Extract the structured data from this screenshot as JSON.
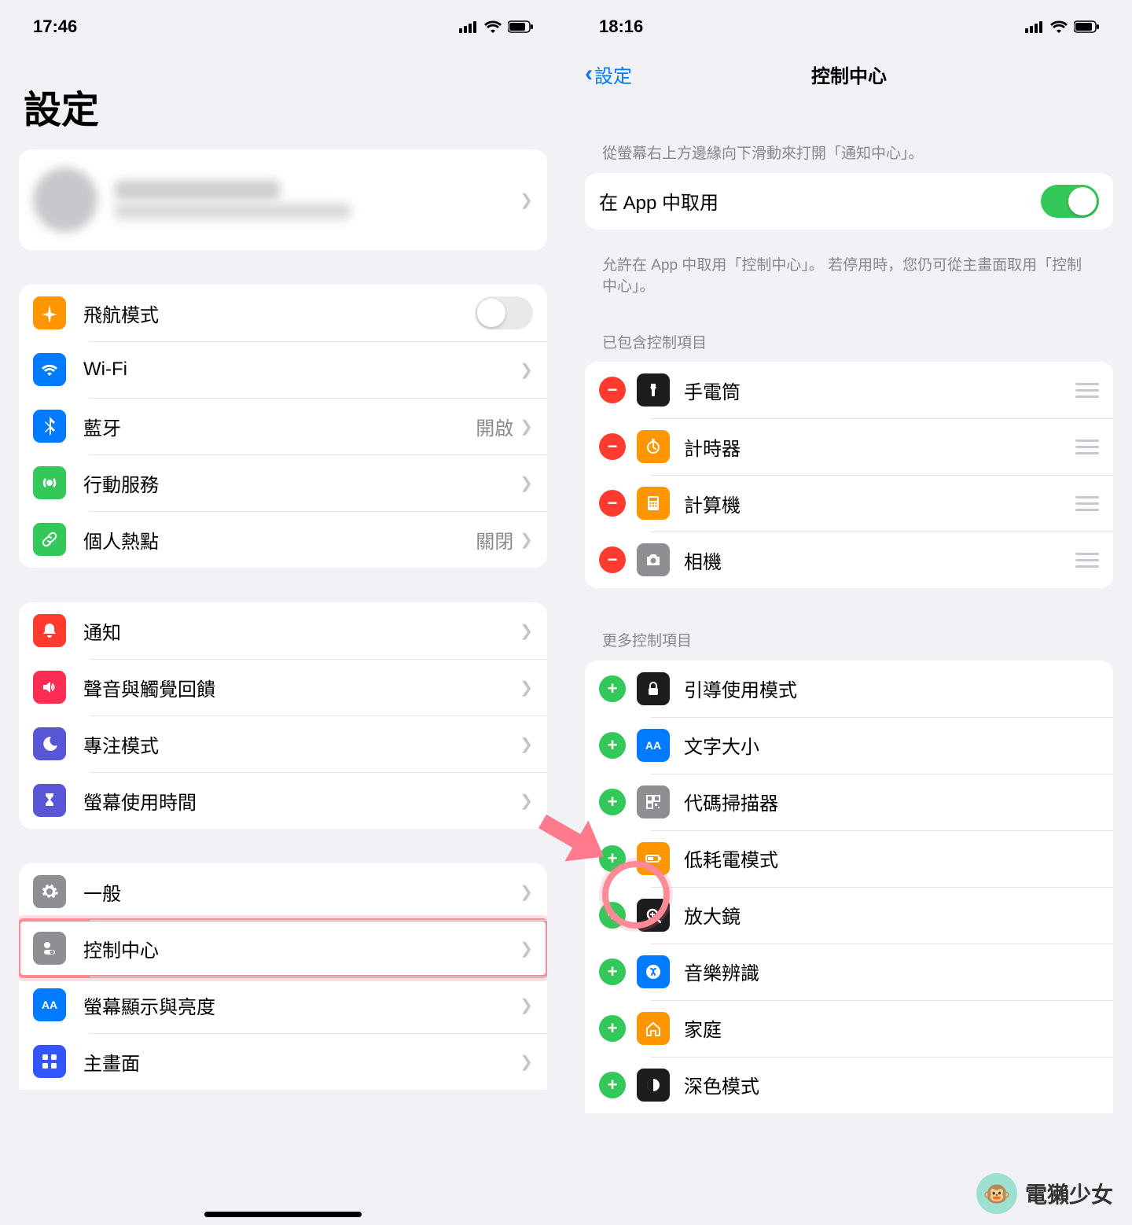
{
  "left": {
    "time": "17:46",
    "title": "設定",
    "rows_connectivity": [
      {
        "label": "飛航模式",
        "icon": "airplane",
        "color": "#ff9500",
        "tail": "",
        "toggle": false
      },
      {
        "label": "Wi-Fi",
        "icon": "wifi",
        "color": "#007aff",
        "tail": "",
        "chev": true
      },
      {
        "label": "藍牙",
        "icon": "bluetooth",
        "color": "#007aff",
        "tail": "開啟",
        "chev": true
      },
      {
        "label": "行動服務",
        "icon": "antenna",
        "color": "#34c759",
        "tail": "",
        "chev": true
      },
      {
        "label": "個人熱點",
        "icon": "link",
        "color": "#34c759",
        "tail": "關閉",
        "chev": true
      }
    ],
    "rows_notifications": [
      {
        "label": "通知",
        "icon": "bell",
        "color": "#ff3b30"
      },
      {
        "label": "聲音與觸覺回饋",
        "icon": "speaker",
        "color": "#ff2d55"
      },
      {
        "label": "專注模式",
        "icon": "moon",
        "color": "#5856d6"
      },
      {
        "label": "螢幕使用時間",
        "icon": "hourglass",
        "color": "#5856d6"
      }
    ],
    "rows_general": [
      {
        "label": "一般",
        "icon": "gear",
        "color": "#8e8e93"
      },
      {
        "label": "控制中心",
        "icon": "switches",
        "color": "#8e8e93",
        "highlight": true
      },
      {
        "label": "螢幕顯示與亮度",
        "icon": "aa",
        "color": "#007aff"
      },
      {
        "label": "主畫面",
        "icon": "grid",
        "color": "#3355ff"
      }
    ]
  },
  "right": {
    "time": "18:16",
    "back_label": "設定",
    "title": "控制中心",
    "header_top": "從螢幕右上方邊緣向下滑動來打開「通知中心」。",
    "access_label": "在 App 中取用",
    "access_toggle": true,
    "footer_access": "允許在 App 中取用「控制中心」。 若停用時，您仍可從主畫面取用「控制中心」。",
    "section_included": "已包含控制項目",
    "included": [
      {
        "label": "手電筒",
        "icon": "flashlight",
        "color": "#1c1c1e"
      },
      {
        "label": "計時器",
        "icon": "timer",
        "color": "#ff9500"
      },
      {
        "label": "計算機",
        "icon": "calculator",
        "color": "#ff9500"
      },
      {
        "label": "相機",
        "icon": "camera",
        "color": "#8e8e93"
      }
    ],
    "section_more": "更多控制項目",
    "more": [
      {
        "label": "引導使用模式",
        "icon": "lock",
        "color": "#1c1c1e"
      },
      {
        "label": "文字大小",
        "icon": "aa",
        "color": "#007aff"
      },
      {
        "label": "代碼掃描器",
        "icon": "qr",
        "color": "#8e8e93",
        "circled": true
      },
      {
        "label": "低耗電模式",
        "icon": "battery",
        "color": "#ff9500"
      },
      {
        "label": "放大鏡",
        "icon": "magnify",
        "color": "#1c1c1e"
      },
      {
        "label": "音樂辨識",
        "icon": "shazam",
        "color": "#007aff"
      },
      {
        "label": "家庭",
        "icon": "home",
        "color": "#ff9500"
      },
      {
        "label": "深色模式",
        "icon": "darkmode",
        "color": "#1c1c1e"
      }
    ]
  },
  "watermark": "電獺少女"
}
